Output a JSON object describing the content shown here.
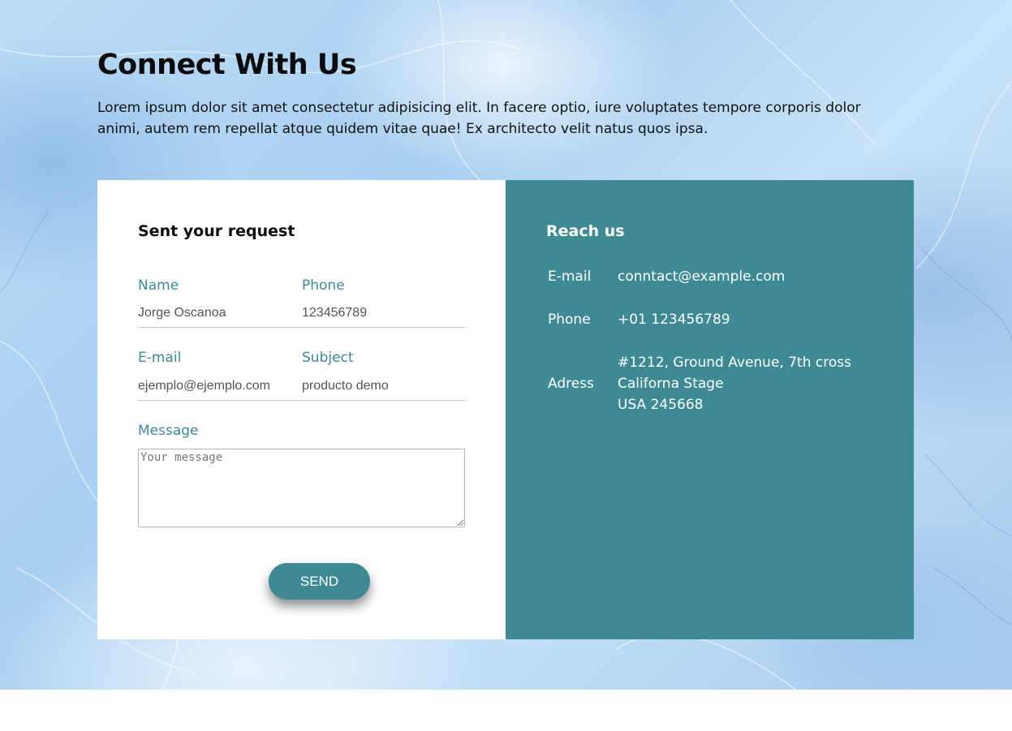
{
  "header": {
    "title": "Connect With Us",
    "intro": "Lorem ipsum dolor sit amet consectetur adipisicing elit. In facere optio, iure voluptates tempore corporis dolor animi, autem rem repellat atque quidem vitae quae! Ex architecto velit natus quos ipsa."
  },
  "form": {
    "title": "Sent your request",
    "name_label": "Name",
    "name_placeholder": "Jorge Oscanoa",
    "phone_label": "Phone",
    "phone_placeholder": "123456789",
    "email_label": "E-mail",
    "email_placeholder": "ejemplo@ejemplo.com",
    "subject_label": "Subject",
    "subject_placeholder": "producto demo",
    "message_label": "Message",
    "message_placeholder": "Your message",
    "send_label": "SEND"
  },
  "contact": {
    "title": "Reach us",
    "email_label": "E-mail",
    "email_value": "conntact@example.com",
    "phone_label": "Phone",
    "phone_value": "+01 123456789",
    "address_label": "Adress",
    "address_lines": [
      "#1212, Ground Avenue, 7th cross",
      "Californa Stage",
      "USA 245668"
    ]
  },
  "colors": {
    "accent": "#3d8a94",
    "background": "#a9cff1"
  }
}
